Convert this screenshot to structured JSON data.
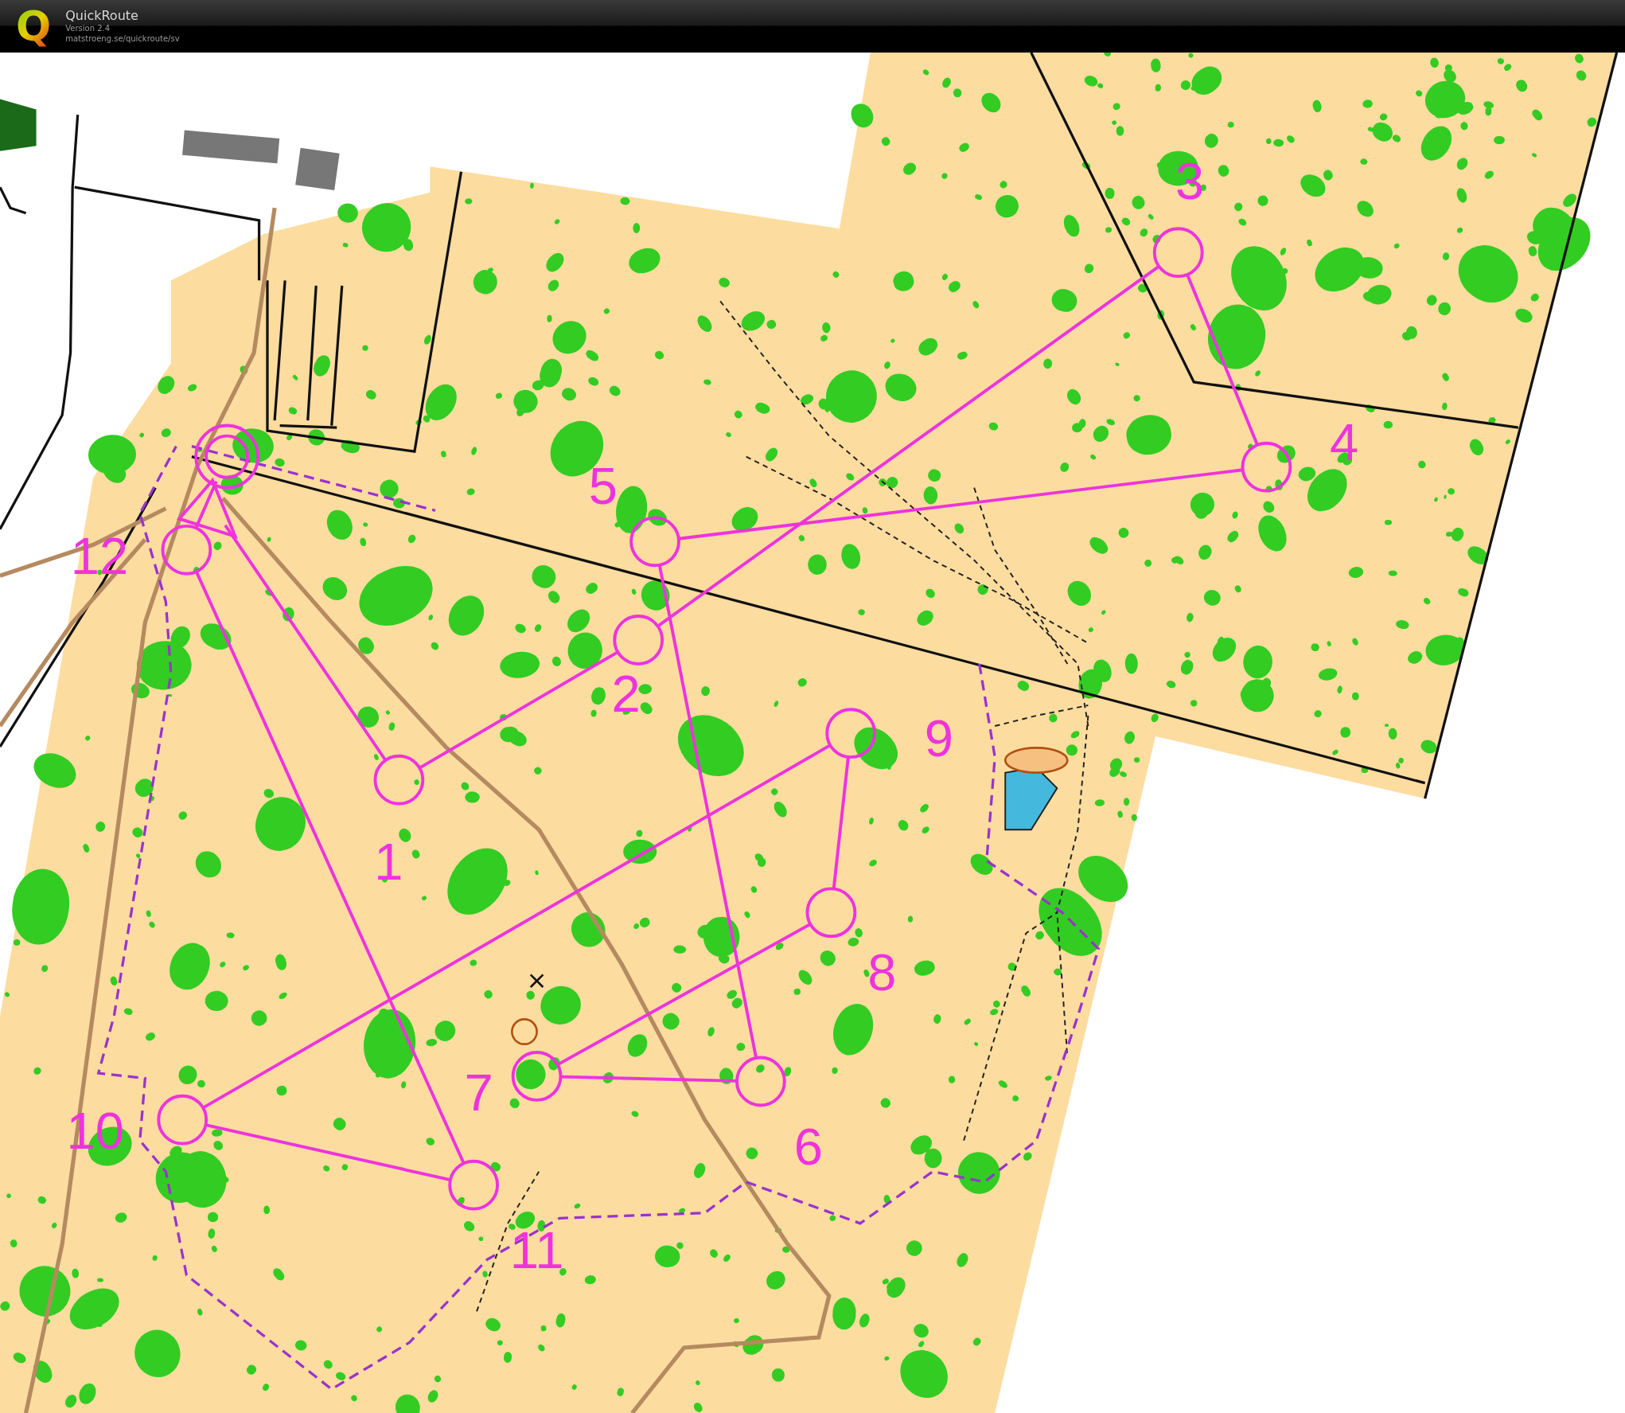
{
  "header": {
    "logo_letter": "Q",
    "title": "QuickRoute",
    "version": "Version 2.4",
    "url": "matstroeng.se/quickroute/sv"
  },
  "controls": [
    {
      "number": "1"
    },
    {
      "number": "2"
    },
    {
      "number": "3"
    },
    {
      "number": "4"
    },
    {
      "number": "5"
    },
    {
      "number": "6"
    },
    {
      "number": "7"
    },
    {
      "number": "8"
    },
    {
      "number": "9"
    },
    {
      "number": "10"
    },
    {
      "number": "11"
    },
    {
      "number": "12"
    }
  ]
}
